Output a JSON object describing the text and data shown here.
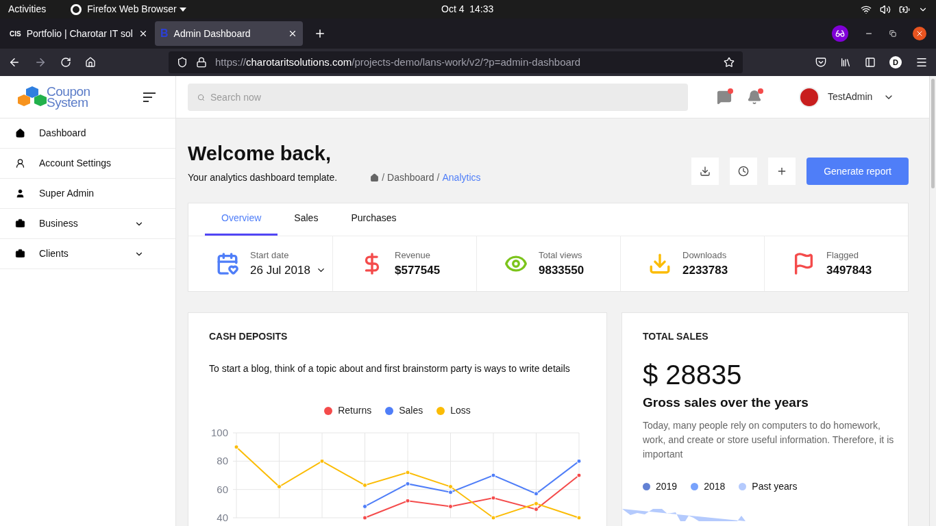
{
  "os_bar": {
    "activities": "Activities",
    "app_menu": "Firefox Web Browser",
    "clock": "Oct 4  14:33"
  },
  "browser": {
    "tabs": [
      {
        "title": "Portfolio | Charotar IT sol",
        "favicon": "CIS",
        "selected": false
      },
      {
        "title": "Admin Dashboard",
        "favicon": "B",
        "selected": true
      }
    ],
    "url": {
      "scheme": "https://",
      "host": "charotaritsolutions.com",
      "path": "/projects-demo/lans-work/v2/?p=admin-dashboard"
    },
    "profile_letter": "D"
  },
  "sidebar": {
    "logo": {
      "line1": "Coupon",
      "line2": "System"
    },
    "items": [
      {
        "label": "Dashboard",
        "expandable": false
      },
      {
        "label": "Account Settings",
        "expandable": false
      },
      {
        "label": "Super Admin",
        "expandable": false
      },
      {
        "label": "Business",
        "expandable": true
      },
      {
        "label": "Clients",
        "expandable": true
      }
    ]
  },
  "header": {
    "search": {
      "placeholder": "Search now"
    },
    "messages_unread": true,
    "notifications_unread": true,
    "user": "TestAdmin"
  },
  "page": {
    "title": "Welcome back,",
    "subtitle": "Your analytics dashboard template.",
    "breadcrumb": [
      {
        "label": "Dashboard",
        "current": false
      },
      {
        "label": "Analytics",
        "current": true
      }
    ],
    "breadcrumb_separator": "/",
    "primary_action": "Generate report"
  },
  "tabs": [
    {
      "label": "Overview",
      "selected": true
    },
    {
      "label": "Sales",
      "selected": false
    },
    {
      "label": "Purchases",
      "selected": false
    }
  ],
  "stats": [
    {
      "kind": "date",
      "label": "Start date",
      "value": "26 Jul 2018"
    },
    {
      "kind": "stat",
      "label": "Revenue",
      "value": "$577545"
    },
    {
      "kind": "stat",
      "label": "Total views",
      "value": "9833550"
    },
    {
      "kind": "stat",
      "label": "Downloads",
      "value": "2233783"
    },
    {
      "kind": "stat",
      "label": "Flagged",
      "value": "3497843"
    }
  ],
  "cash_deposits": {
    "title": "CASH DEPOSITS",
    "text": "To start a blog, think of a topic about and first brainstorm party is ways to write details",
    "chart_data": {
      "type": "line",
      "grid": true,
      "legend": true,
      "yticks": [
        40,
        60,
        80,
        100
      ],
      "ylim": [
        40,
        100
      ],
      "series": [
        {
          "name": "Returns",
          "color": "#f44b4b",
          "marker": "circle",
          "values": [
            null,
            null,
            null,
            40,
            52,
            48,
            54,
            46,
            70
          ]
        },
        {
          "name": "Sales",
          "color": "#4f7ef8",
          "marker": "circle",
          "values": [
            null,
            null,
            null,
            48,
            64,
            58,
            70,
            57,
            80
          ]
        },
        {
          "name": "Loss",
          "color": "#fbbc05",
          "marker": "circle",
          "values": [
            90,
            62,
            80,
            63,
            72,
            62,
            40,
            50,
            40
          ]
        }
      ]
    }
  },
  "total_sales": {
    "title": "TOTAL SALES",
    "amount": "$ 28835",
    "heading": "Gross sales over the years",
    "text": "Today, many people rely on computers to do homework, work, and create or store useful information. Therefore, it is important",
    "legend": [
      {
        "label": "2019",
        "color": "#6281d4"
      },
      {
        "label": "2018",
        "color": "#78a2fc"
      },
      {
        "label": "Past years",
        "color": "#b4cafd"
      }
    ]
  }
}
